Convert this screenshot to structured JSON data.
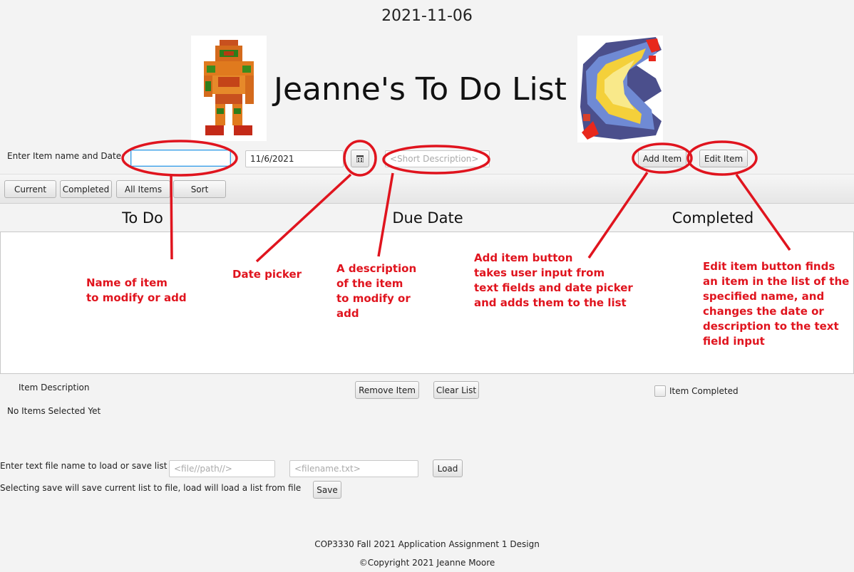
{
  "header": {
    "date": "2021-11-06",
    "title": "Jeanne's To Do List"
  },
  "images": {
    "left": "samus-pixel-sprite",
    "right": "flame-emblem-pixel-sprite"
  },
  "input_row": {
    "label": "Enter Item name and Date:",
    "name_value": "",
    "date_value": "11/6/2021",
    "calendar_icon": "calendar-icon",
    "description_placeholder": "<Short Description>",
    "add_label": "Add Item",
    "edit_label": "Edit Item"
  },
  "filters": [
    "Current",
    "Completed",
    "All Items",
    "Sort"
  ],
  "columns": [
    "To Do",
    "Due Date",
    "Completed"
  ],
  "details": {
    "description_label": "Item Description",
    "selection_text": "No Items Selected Yet",
    "remove_label": "Remove Item",
    "clear_label": "Clear List",
    "completed_label": "Item Completed",
    "completed_checked": false
  },
  "file": {
    "prompt": "Enter text file name to load or save list to",
    "path_placeholder": "<file//path//>",
    "name_placeholder": "<filename.txt>",
    "load_label": "Load",
    "save_hint": "Selecting save will save current list to file, load will load a list from file",
    "save_label": "Save"
  },
  "footer": {
    "course": "COP3330 Fall 2021 Application Assignment 1 Design",
    "copyright": "©Copyright 2021 Jeanne Moore"
  },
  "annotations": {
    "color": "#e0141e",
    "name_note": "Name of item\nto modify or add",
    "date_note": "Date picker",
    "desc_note": "A description\nof the item\nto modify or\nadd",
    "add_note": "Add item button\ntakes user input from\ntext fields and date picker\nand adds them to the list",
    "edit_note": "Edit item button finds\nan item in the list of the\nspecified name, and\nchanges the date or\ndescription to the text\nfield input"
  }
}
